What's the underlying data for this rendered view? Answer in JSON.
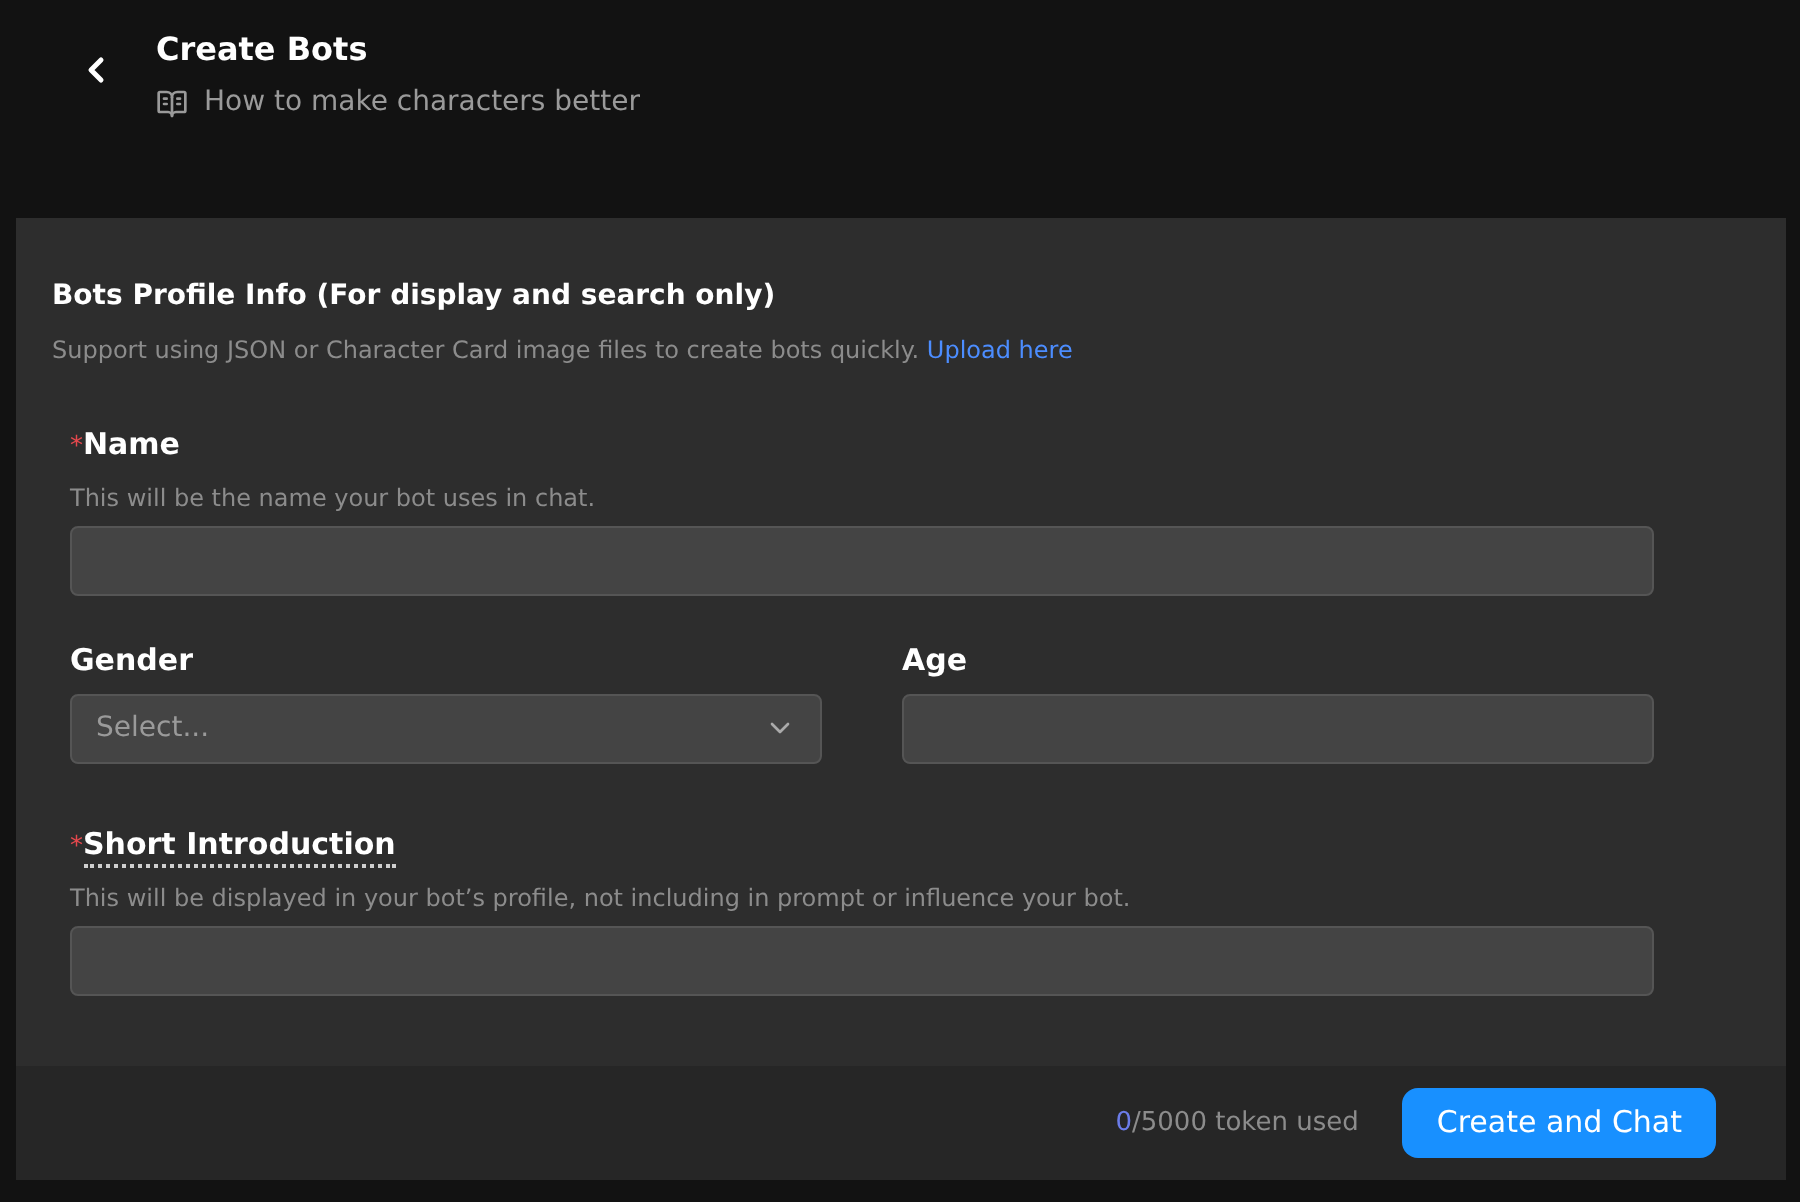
{
  "header": {
    "title": "Create Bots",
    "guide_link": "How to make characters better"
  },
  "section": {
    "title": "Bots Profile Info (For display and search only)",
    "description": "Support using JSON or Character Card image files to create bots quickly.",
    "link": "Upload here"
  },
  "fields": [
    {
      "kind": "text",
      "label": "Name",
      "required_mark": "*",
      "hint": "This will be the name your bot uses in chat."
    },
    {
      "kind": "pair",
      "items": [
        {
          "kind": "select",
          "label": "Gender",
          "placeholder": "Select..."
        },
        {
          "kind": "text",
          "label": "Age"
        }
      ]
    },
    {
      "kind": "text",
      "label": "Short Introduction",
      "required_mark": "*",
      "tooltip": true,
      "hint": "This will be displayed in your bot’s profile, not including in prompt or influence your bot."
    }
  ],
  "footer": {
    "tokens_used": "0",
    "tokens_total": "/5000 token used",
    "button": "Create and Chat"
  }
}
